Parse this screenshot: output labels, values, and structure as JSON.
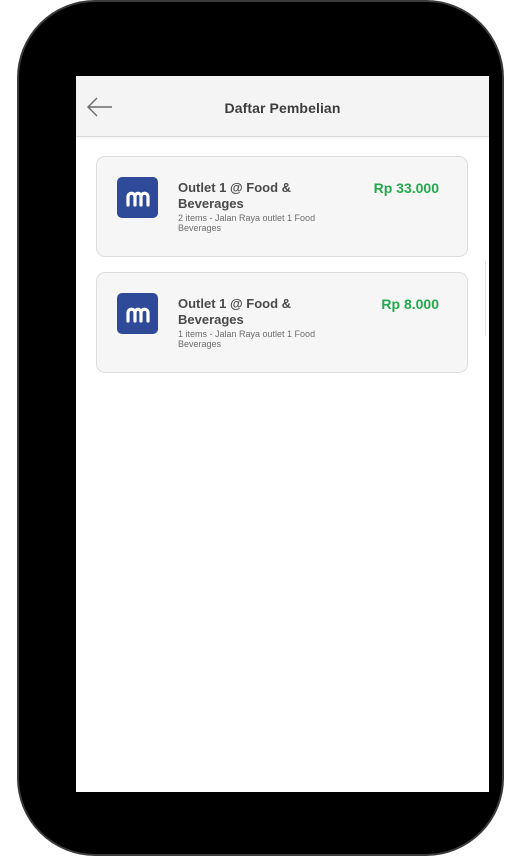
{
  "header": {
    "title": "Daftar Pembelian",
    "back_icon": "arrow-left-icon"
  },
  "purchases": [
    {
      "outlet": "Outlet 1 @ Food & Beverages",
      "description": "2 items - Jalan Raya outlet 1 Food Beverages",
      "price": "Rp 33.000",
      "logo_icon": "outlet-logo-icon"
    },
    {
      "outlet": "Outlet 1 @ Food & Beverages",
      "description": "1 items - Jalan Raya outlet 1 Food Beverages",
      "price": "Rp 8.000",
      "logo_icon": "outlet-logo-icon"
    }
  ],
  "colors": {
    "price": "#22a94a",
    "logo_bg": "#2f4a98",
    "appbar_bg": "#f4f4f4"
  }
}
